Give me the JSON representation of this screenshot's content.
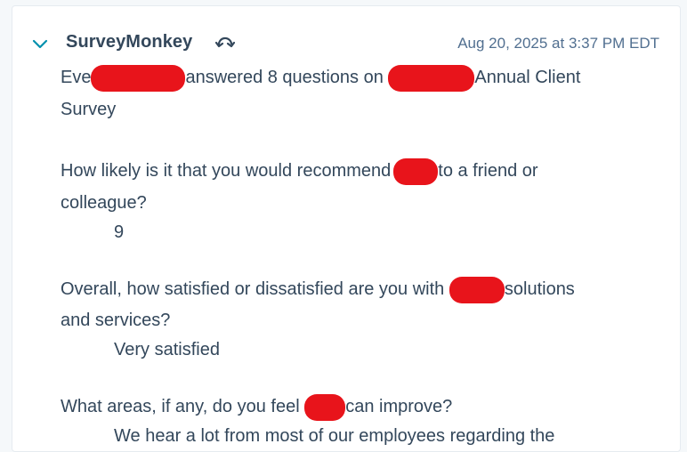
{
  "sender": "SurveyMonkey",
  "timestamp": "Aug 20, 2025 at 3:37 PM EDT",
  "icons": {
    "collapse": "chevron-down-icon",
    "sync": "sync-icon"
  },
  "colors": {
    "redaction": "#e8141b",
    "accent": "#0091ae",
    "text": "#33475b"
  },
  "summary": {
    "prefix": "Eve",
    "middle": "answered 8 questions on",
    "suffix": "Annual Client",
    "line2": "Survey"
  },
  "questions": [
    {
      "q_part1": "How likely is it that you would recommend",
      "q_part2": "to a friend or",
      "q_line2": "colleague?",
      "answer": "9"
    },
    {
      "q_part1": "Overall, how satisfied or dissatisfied are you with",
      "q_part2": "solutions",
      "q_line2": "and services?",
      "answer": "Very satisfied"
    },
    {
      "q_part1": "What areas, if any, do you feel",
      "q_part2": "can improve?",
      "answer": "We hear a lot from most of our employees regarding the"
    }
  ]
}
